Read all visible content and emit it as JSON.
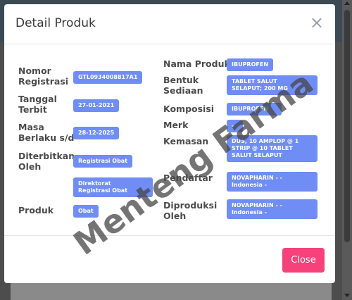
{
  "modal": {
    "title": "Detail Produk",
    "close_icon": "×",
    "close_button_label": "Close"
  },
  "left": {
    "nomor_registrasi_label": "Nomor\nRegistrasi",
    "nomor_registrasi_value": "GTL0934008817A1",
    "tanggal_terbit_label": "Tanggal\nTerbit",
    "tanggal_terbit_value": "27-01-2021",
    "masa_berlaku_label": "Masa\nBerlaku s/d",
    "masa_berlaku_value": "28-12-2025",
    "diterbitkan_label": "Diterbitkan\nOleh",
    "diterbitkan_value_1": "Registrasi Obat",
    "diterbitkan_value_2": "Direktorat\nRegistrasi Obat",
    "produk_label": "Produk",
    "produk_value": "Obat"
  },
  "right": {
    "nama_produk_label": "Nama Produk",
    "nama_produk_value": "IBUPROFEN",
    "bentuk_sediaan_label": "Bentuk\nSediaan",
    "bentuk_sediaan_value": "TABLET SALUT\nSELAPUT; 200 MG",
    "komposisi_label": "Komposisi",
    "komposisi_value": "IBUPROFEN",
    "merk_label": "Merk",
    "merk_value": "-",
    "kemasan_label": "Kemasan",
    "kemasan_value": "DUS, 10 AMPLOP @ 1\nSTRIP @ 10 TABLET\nSALUT SELAPUT",
    "pendaftar_label": "Pendaftar",
    "pendaftar_value": "NOVAPHARIN -          -\nIndonesia               -",
    "diproduksi_label": "Diproduksi\nOleh",
    "diproduksi_value": "NOVAPHARIN -          -\nIndonesia               -"
  },
  "watermark_text": "Menteng Farma"
}
